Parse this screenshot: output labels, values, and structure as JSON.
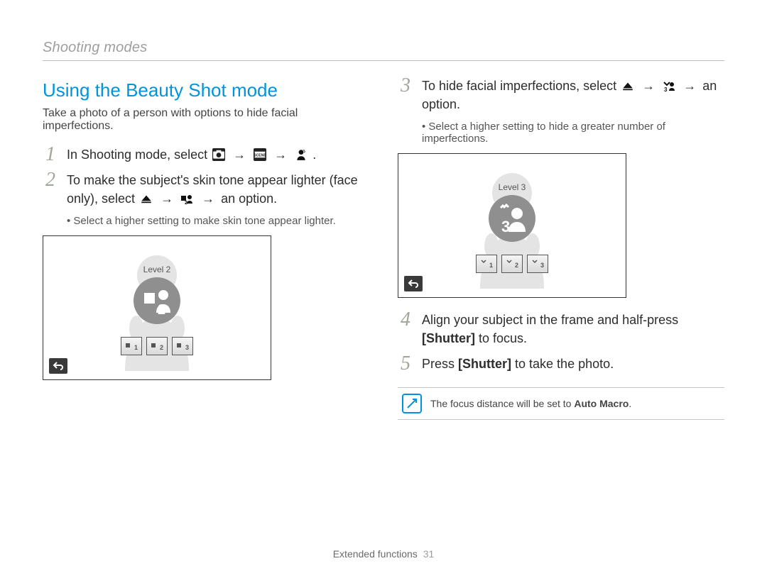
{
  "breadcrumb": "Shooting modes",
  "title": "Using the Beauty Shot mode",
  "lead": "Take a photo of a person with options to hide facial imperfections.",
  "left": {
    "step1": {
      "num": "1",
      "pre": "In Shooting mode, select ",
      "post": "."
    },
    "step2": {
      "num": "2",
      "pre": "To make the subject's skin tone appear lighter (face only), select ",
      "post": " an option."
    },
    "sub2": "Select a higher setting to make skin tone appear lighter.",
    "shot_level": "Level 2"
  },
  "right": {
    "step3": {
      "num": "3",
      "pre": "To hide facial imperfections, select ",
      "post": " an option."
    },
    "sub3": "Select a higher setting to hide a greater number of imperfections.",
    "shot_level": "Level 3",
    "step4": {
      "num": "4",
      "pre": "Align your subject in the frame and half-press ",
      "bold": "[Shutter]",
      "post": " to focus."
    },
    "step5": {
      "num": "5",
      "pre": "Press ",
      "bold": "[Shutter]",
      "post": " to take the photo."
    },
    "note_pre": "The focus distance will be set to ",
    "note_bold": "Auto Macro",
    "note_post": "."
  },
  "footer": {
    "section": "Extended functions",
    "page": "31"
  },
  "icons": {
    "camera": "camera-icon",
    "scene": "scene-icon",
    "beauty": "beauty-icon",
    "menu_up": "menu-up-icon",
    "facetone": "face-tone-icon",
    "retouch": "face-retouch-icon",
    "back": "back-icon"
  }
}
